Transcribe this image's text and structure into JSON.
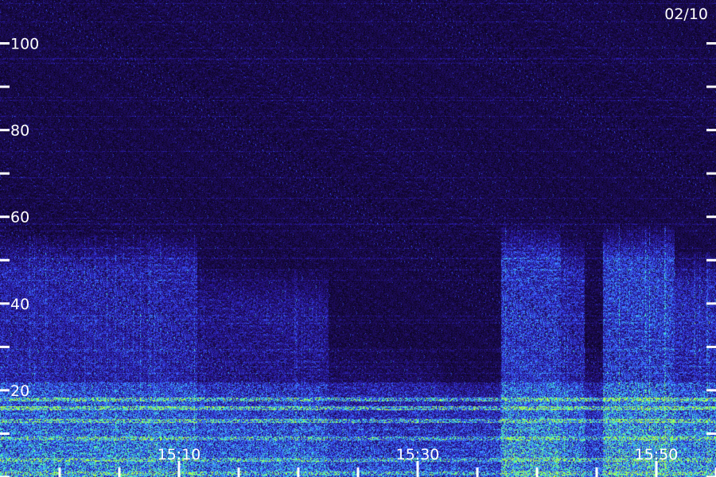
{
  "date_label": "02/10",
  "chart_data": {
    "type": "heatmap",
    "title": "",
    "xlabel": "",
    "ylabel": "",
    "x_tick_labels": [
      "15:10",
      "15:30",
      "15:50"
    ],
    "x_tick_minutes": [
      10,
      30,
      50
    ],
    "x_range_minutes": [
      -5,
      55
    ],
    "x_minor_tick_minutes": [
      0,
      5,
      10,
      15,
      20,
      25,
      30,
      35,
      40,
      45,
      50,
      55
    ],
    "y_range": [
      0,
      110
    ],
    "y_ticks": [
      20,
      40,
      60,
      80,
      100
    ],
    "y_minor_ticks": [
      0,
      10,
      30,
      50,
      70,
      90
    ],
    "colormap": [
      "#000000",
      "#1a0a4a",
      "#2a1aa8",
      "#3a55ff",
      "#3fb4ff",
      "#46ffb0",
      "#b8ff3c"
    ],
    "low_frequency_bands": [
      {
        "y": 18,
        "level": 0.75
      },
      {
        "y": 16,
        "level": 0.85
      },
      {
        "y": 13,
        "level": 0.6
      },
      {
        "y": 9,
        "level": 0.55
      },
      {
        "y": 4,
        "level": 0.5
      },
      {
        "y": 1,
        "level": 0.45
      }
    ],
    "broadband_segments": [
      {
        "start_min": -5,
        "end_min": 11.5,
        "y_max": 56,
        "level": 0.55
      },
      {
        "start_min": 11.5,
        "end_min": 22.5,
        "y_max": 48,
        "level": 0.35
      },
      {
        "start_min": 22.5,
        "end_min": 32,
        "y_max": 30,
        "level": 0.15
      },
      {
        "start_min": 32,
        "end_min": 37,
        "y_max": 25,
        "level": 0.12
      },
      {
        "start_min": 37,
        "end_min": 42,
        "y_max": 58,
        "level": 0.75
      },
      {
        "start_min": 42,
        "end_min": 44,
        "y_max": 55,
        "level": 0.55
      },
      {
        "start_min": 44,
        "end_min": 45.5,
        "y_max": 30,
        "level": 0.2
      },
      {
        "start_min": 45.5,
        "end_min": 51.5,
        "y_max": 58,
        "level": 0.8
      },
      {
        "start_min": 51.5,
        "end_min": 55,
        "y_max": 52,
        "level": 0.6
      }
    ]
  }
}
